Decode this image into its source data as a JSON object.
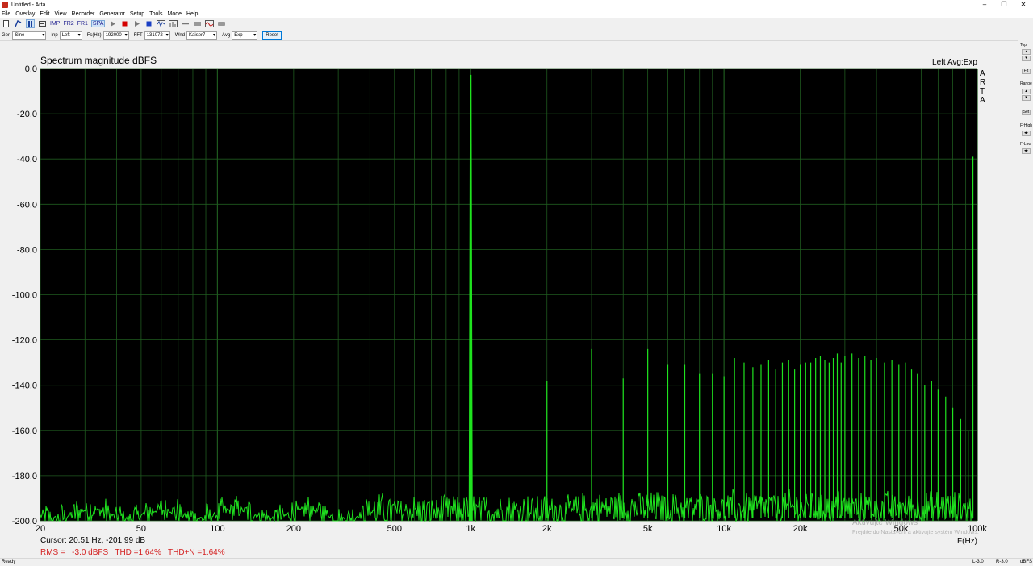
{
  "window": {
    "title": "Untitled - Arta",
    "minimize": "–",
    "maximize": "❐",
    "close": "✕"
  },
  "menu": [
    "File",
    "Overlay",
    "Edit",
    "View",
    "Recorder",
    "Generator",
    "Setup",
    "Tools",
    "Mode",
    "Help"
  ],
  "toolbar": {
    "imp": "IMP",
    "fr2": "FR2",
    "fr1": "FR1",
    "spa": "SPA"
  },
  "controls": {
    "gen_label": "Gen",
    "gen_value": "Sine",
    "inp_label": "Inp",
    "inp_value": "Left",
    "fs_label": "Fs(Hz)",
    "fs_value": "192000",
    "fft_label": "FFT",
    "fft_value": "131072",
    "wnd_label": "Wnd",
    "wnd_value": "Kaiser7",
    "avg_label": "Avg",
    "avg_value": "Exp",
    "reset_label": "Reset"
  },
  "right_panel": {
    "top": "Top",
    "fit": "Fit",
    "range": "Range",
    "set": "Set",
    "frhigh": "FrHigh",
    "frlow": "FrLow"
  },
  "plot": {
    "title": "Spectrum magnitude dBFS",
    "channel_info": "Left  Avg:Exp",
    "logo_letters": [
      "A",
      "R",
      "T",
      "A"
    ],
    "x_unit": "F(Hz)",
    "cursor": "Cursor: 20.51 Hz, -201.99 dB",
    "stats": "RMS =   -3.0 dBFS   THD =1.64%   THD+N =1.64%",
    "watermark_1": "Aktivujte Windows",
    "watermark_2": "Prejdite do Nastavení a aktivujte systém Windows."
  },
  "status": {
    "left": "Ready",
    "r1": "L-3.0",
    "r2": "R-3.0",
    "r3": "dBFS"
  },
  "colors": {
    "plot_bg": "#000000",
    "grid": "#1f5a1f",
    "trace": "#1fe31f",
    "stats_text": "#d42020",
    "axis_text": "#000000"
  },
  "chart_data": {
    "type": "line",
    "x_scale": "log",
    "xlim": [
      20,
      100000
    ],
    "ylim": [
      -200,
      0
    ],
    "x_ticks": [
      20,
      50,
      100,
      200,
      500,
      1000,
      2000,
      5000,
      10000,
      20000,
      50000,
      100000
    ],
    "x_tick_labels": [
      "20",
      "50",
      "100",
      "200",
      "500",
      "1k",
      "2k",
      "5k",
      "10k",
      "20k",
      "50k",
      "100k"
    ],
    "y_ticks": [
      0,
      -20,
      -40,
      -60,
      -80,
      -100,
      -120,
      -140,
      -160,
      -180,
      -200
    ],
    "y_tick_labels": [
      "0.0",
      "-20.0",
      "-40.0",
      "-60.0",
      "-80.0",
      "-100.0",
      "-120.0",
      "-140.0",
      "-160.0",
      "-180.0",
      "-200.0"
    ],
    "grid": true,
    "fundamental": {
      "freq": 1000,
      "level": -3
    },
    "harmonics": [
      [
        2000,
        -138
      ],
      [
        3000,
        -124
      ],
      [
        4000,
        -137
      ],
      [
        5000,
        -124
      ],
      [
        6000,
        -131
      ],
      [
        7000,
        -131
      ],
      [
        8000,
        -135
      ],
      [
        9000,
        -135
      ],
      [
        10000,
        -136
      ],
      [
        11000,
        -128
      ],
      [
        12000,
        -130
      ],
      [
        13000,
        -132
      ],
      [
        14000,
        -131
      ],
      [
        15000,
        -129
      ],
      [
        16000,
        -133
      ],
      [
        17000,
        -130
      ],
      [
        18000,
        -129
      ],
      [
        19000,
        -133
      ],
      [
        20000,
        -131
      ],
      [
        21000,
        -130
      ],
      [
        22000,
        -130
      ],
      [
        23000,
        -128
      ],
      [
        24000,
        -127
      ],
      [
        25000,
        -129
      ],
      [
        26000,
        -130
      ],
      [
        27000,
        -128
      ],
      [
        28000,
        -126
      ],
      [
        29000,
        -130
      ],
      [
        30000,
        -127
      ],
      [
        32000,
        -126
      ],
      [
        34000,
        -128
      ],
      [
        36000,
        -127
      ],
      [
        38000,
        -129
      ],
      [
        40000,
        -128
      ],
      [
        43000,
        -130
      ],
      [
        46000,
        -129
      ],
      [
        49000,
        -131
      ],
      [
        52000,
        -130
      ],
      [
        55000,
        -133
      ],
      [
        58000,
        -135
      ],
      [
        62000,
        -140
      ],
      [
        66000,
        -138
      ],
      [
        70000,
        -142
      ],
      [
        75000,
        -145
      ],
      [
        80000,
        -150
      ],
      [
        86000,
        -155
      ],
      [
        92000,
        -160
      ]
    ],
    "spur": {
      "freq": 96000,
      "level": -39
    },
    "noise_floor": -195
  }
}
